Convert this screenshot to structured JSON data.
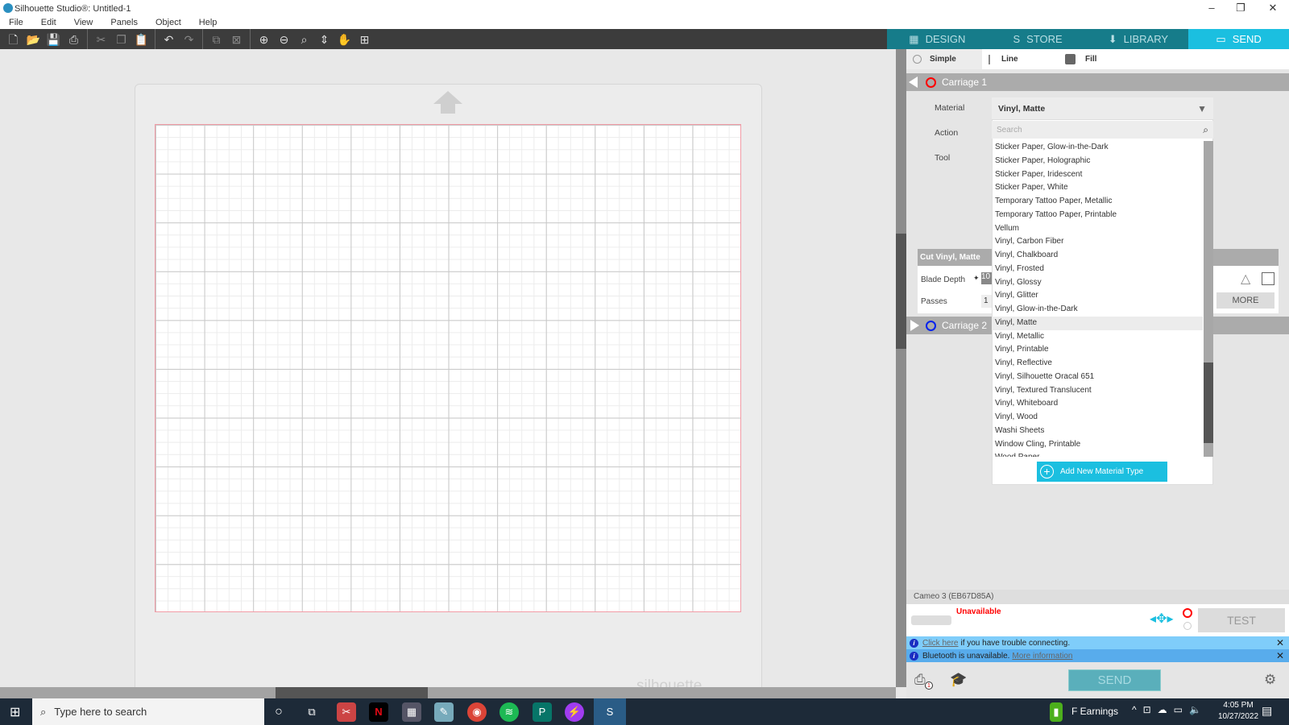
{
  "window": {
    "title": "Silhouette Studio®: Untitled-1",
    "minimize": "–",
    "restore": "❐",
    "close": "✕"
  },
  "menu": [
    "File",
    "Edit",
    "View",
    "Panels",
    "Object",
    "Help"
  ],
  "tabs": [
    {
      "label": "DESIGN",
      "icon": "▦"
    },
    {
      "label": "STORE",
      "icon": "S"
    },
    {
      "label": "LIBRARY",
      "icon": "⬇"
    },
    {
      "label": "SEND",
      "icon": "▭"
    }
  ],
  "active_tab": "SEND",
  "modes": {
    "simple": "Simple",
    "line": "Line",
    "fill": "Fill"
  },
  "carriage1": {
    "label": "Carriage 1",
    "material_label": "Material",
    "action_label": "Action",
    "tool_label": "Tool",
    "material_value": "Vinyl, Matte",
    "search_placeholder": "Search"
  },
  "materials": [
    "Sticker Paper, Glow-in-the-Dark",
    "Sticker Paper, Holographic",
    "Sticker Paper, Iridescent",
    "Sticker Paper, White",
    "Temporary Tattoo Paper, Metallic",
    "Temporary Tattoo Paper, Printable",
    "Vellum",
    "Vinyl, Carbon Fiber",
    "Vinyl, Chalkboard",
    "Vinyl, Frosted",
    "Vinyl, Glossy",
    "Vinyl, Glitter",
    "Vinyl, Glow-in-the-Dark",
    "Vinyl, Matte",
    "Vinyl, Metallic",
    "Vinyl, Printable",
    "Vinyl, Reflective",
    "Vinyl, Silhouette Oracal 651",
    "Vinyl, Textured Translucent",
    "Vinyl, Whiteboard",
    "Vinyl, Wood",
    "Washi Sheets",
    "Window Cling, Printable",
    "Wood Paper"
  ],
  "selected_material": "Vinyl, Matte",
  "add_material": "Add New Material Type",
  "cut": {
    "header": "Cut Vinyl, Matte",
    "blade_depth_label": "Blade Depth",
    "blade_depth_value": "10",
    "passes_label": "Passes",
    "passes_value": "1",
    "more": "MORE"
  },
  "carriage2": {
    "label": "Carriage 2"
  },
  "device": {
    "name": "Cameo 3 (EB67D85A)",
    "status": "Unavailable",
    "test": "TEST"
  },
  "notices": [
    {
      "link": "Click here",
      "text": "if you have trouble connecting."
    },
    {
      "text": "Bluetooth is unavailable.",
      "link": "More information"
    }
  ],
  "send_button": "SEND",
  "queue_count": "1",
  "mat_logo": "silhouette",
  "taskbar": {
    "search_placeholder": "Type here to search",
    "stock": "F  Earnings",
    "time": "4:05 PM",
    "date": "10/27/2022"
  },
  "colors": {
    "teal": "#167c8a",
    "accent": "#1bbfe0",
    "error": "#ff0000"
  }
}
